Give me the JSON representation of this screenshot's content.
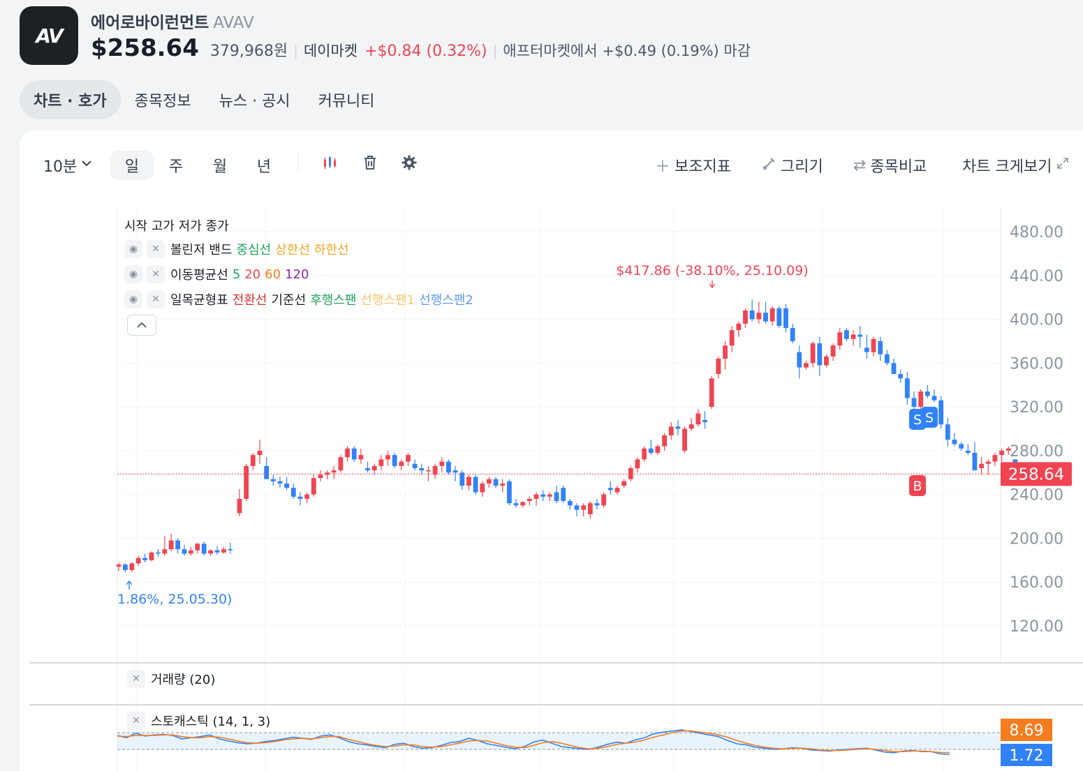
{
  "header": {
    "logo_text": "AV",
    "name": "에어로바이런먼트",
    "ticker": "AVAV",
    "price": "$258.64",
    "price_krw": "379,968원",
    "market_label": "데이마켓",
    "change": "+$0.84 (0.32%)",
    "after_market": "애프터마켓에서 +$0.49 (0.19%) 마감"
  },
  "tabs": [
    "차트 · 호가",
    "종목정보",
    "뉴스 · 공시",
    "커뮤니티"
  ],
  "toolbar": {
    "interval": "10분",
    "periods": [
      "일",
      "주",
      "월",
      "년"
    ],
    "indicator": "보조지표",
    "draw": "그리기",
    "compare": "종목비교",
    "expand": "차트 크게보기"
  },
  "legend": {
    "ohlc": "시작 고가 저가 종가",
    "bollinger": {
      "title": "볼린저 밴드",
      "items": [
        "중심선",
        "상한선",
        "하한선"
      ]
    },
    "ma": {
      "title": "이동평균선",
      "items": [
        "5",
        "20",
        "60",
        "120"
      ]
    },
    "ichimoku": {
      "title": "일목균형표",
      "items": [
        "전환선",
        "기준선",
        "후행스팬",
        "선행스팬1",
        "선행스팬2"
      ]
    }
  },
  "colors": {
    "up": "#f04452",
    "down": "#3182f6",
    "bb_mid": "#20a45a",
    "bb_upper": "#f5a623",
    "bb_lower": "#f5a623",
    "ma5": "#20a45a",
    "ma20": "#f04452",
    "ma60": "#f57c1f",
    "ma120": "#8e24aa",
    "ich_conv": "#d32f2f",
    "ich_base": "#191f28",
    "ich_lag": "#20a45a",
    "ich_spanA": "#f7c66b",
    "ich_spanB": "#5a9bf0",
    "stoch_k": "#3182f6",
    "stoch_d": "#f57c1f",
    "stoch_band": "#e8f3fd"
  },
  "chart_data": {
    "type": "candlestick",
    "y_ticks": [
      "480.00",
      "440.00",
      "400.00",
      "360.00",
      "320.00",
      "280.00",
      "240.00",
      "200.00",
      "160.00",
      "120.00"
    ],
    "ylim": [
      100,
      490
    ],
    "current_price_label": "258.64",
    "current_price": 258.64,
    "high_annotation": "$417.86 (-38.10%, 25.10.09)",
    "low_annotation": "1.86%, 25.05.30)",
    "markers": [
      {
        "label": "S",
        "type": "sell"
      },
      {
        "label": "S",
        "type": "sell"
      },
      {
        "label": "B",
        "type": "buy"
      }
    ],
    "candles": [
      [
        174,
        178,
        170,
        176
      ],
      [
        176,
        177,
        169,
        171
      ],
      [
        171,
        178,
        169,
        177
      ],
      [
        177,
        184,
        175,
        182
      ],
      [
        182,
        186,
        178,
        180
      ],
      [
        180,
        188,
        179,
        187
      ],
      [
        187,
        190,
        183,
        186
      ],
      [
        186,
        202,
        184,
        190
      ],
      [
        190,
        204,
        188,
        198
      ],
      [
        198,
        200,
        186,
        190
      ],
      [
        190,
        194,
        184,
        186
      ],
      [
        186,
        192,
        184,
        189
      ],
      [
        189,
        196,
        186,
        195
      ],
      [
        195,
        197,
        184,
        186
      ],
      [
        186,
        190,
        184,
        189
      ],
      [
        189,
        193,
        185,
        187
      ],
      [
        187,
        192,
        186,
        190
      ],
      [
        190,
        196,
        186,
        189
      ],
      [
        223,
        245,
        220,
        236
      ],
      [
        236,
        268,
        234,
        266
      ],
      [
        266,
        278,
        262,
        276
      ],
      [
        276,
        290,
        268,
        280
      ],
      [
        266,
        274,
        256,
        254
      ],
      [
        254,
        258,
        248,
        252
      ],
      [
        252,
        256,
        246,
        250
      ],
      [
        250,
        256,
        244,
        246
      ],
      [
        246,
        250,
        236,
        238
      ],
      [
        238,
        242,
        230,
        236
      ],
      [
        236,
        242,
        232,
        240
      ],
      [
        240,
        258,
        238,
        255
      ],
      [
        255,
        262,
        252,
        258
      ],
      [
        258,
        262,
        254,
        260
      ],
      [
        260,
        266,
        254,
        262
      ],
      [
        262,
        276,
        260,
        274
      ],
      [
        274,
        284,
        270,
        282
      ],
      [
        282,
        284,
        270,
        272
      ],
      [
        272,
        282,
        268,
        276
      ],
      [
        264,
        270,
        260,
        262
      ],
      [
        262,
        268,
        258,
        266
      ],
      [
        266,
        276,
        262,
        272
      ],
      [
        272,
        280,
        266,
        276
      ],
      [
        276,
        278,
        264,
        266
      ],
      [
        266,
        272,
        262,
        270
      ],
      [
        270,
        278,
        266,
        276
      ],
      [
        268,
        272,
        262,
        264
      ],
      [
        264,
        268,
        258,
        262
      ],
      [
        262,
        266,
        252,
        262
      ],
      [
        258,
        268,
        254,
        266
      ],
      [
        266,
        274,
        260,
        270
      ],
      [
        270,
        272,
        258,
        260
      ],
      [
        262,
        266,
        252,
        260
      ],
      [
        260,
        262,
        244,
        248
      ],
      [
        248,
        258,
        244,
        256
      ],
      [
        256,
        258,
        240,
        242
      ],
      [
        242,
        252,
        238,
        250
      ],
      [
        250,
        256,
        246,
        254
      ],
      [
        254,
        256,
        246,
        248
      ],
      [
        248,
        254,
        242,
        250
      ],
      [
        252,
        254,
        230,
        232
      ],
      [
        232,
        236,
        228,
        230
      ],
      [
        230,
        234,
        228,
        233
      ],
      [
        234,
        238,
        230,
        236
      ],
      [
        236,
        242,
        230,
        240
      ],
      [
        240,
        244,
        234,
        238
      ],
      [
        238,
        242,
        234,
        240
      ],
      [
        242,
        248,
        232,
        234
      ],
      [
        246,
        248,
        232,
        234
      ],
      [
        234,
        236,
        226,
        230
      ],
      [
        230,
        232,
        220,
        226
      ],
      [
        226,
        232,
        220,
        230
      ],
      [
        222,
        234,
        218,
        232
      ],
      [
        232,
        236,
        226,
        230
      ],
      [
        230,
        242,
        228,
        240
      ],
      [
        246,
        252,
        240,
        244
      ],
      [
        242,
        248,
        240,
        246
      ],
      [
        248,
        254,
        246,
        252
      ],
      [
        254,
        266,
        252,
        264
      ],
      [
        264,
        274,
        260,
        272
      ],
      [
        272,
        284,
        270,
        282
      ],
      [
        282,
        290,
        276,
        278
      ],
      [
        278,
        286,
        276,
        284
      ],
      [
        284,
        296,
        280,
        294
      ],
      [
        294,
        306,
        290,
        302
      ],
      [
        302,
        308,
        294,
        300
      ],
      [
        280,
        302,
        278,
        300
      ],
      [
        300,
        310,
        298,
        304
      ],
      [
        304,
        318,
        302,
        314
      ],
      [
        308,
        316,
        300,
        306
      ],
      [
        320,
        348,
        318,
        346
      ],
      [
        350,
        366,
        346,
        364
      ],
      [
        364,
        380,
        354,
        376
      ],
      [
        376,
        394,
        370,
        390
      ],
      [
        390,
        398,
        384,
        396
      ],
      [
        396,
        410,
        392,
        408
      ],
      [
        408,
        418,
        398,
        400
      ],
      [
        400,
        416,
        396,
        406
      ],
      [
        406,
        416,
        396,
        398
      ],
      [
        398,
        412,
        394,
        410
      ],
      [
        410,
        412,
        392,
        394
      ],
      [
        410,
        414,
        388,
        392
      ],
      [
        392,
        396,
        378,
        380
      ],
      [
        370,
        376,
        346,
        356
      ],
      [
        356,
        362,
        354,
        360
      ],
      [
        360,
        380,
        356,
        378
      ],
      [
        378,
        384,
        348,
        358
      ],
      [
        358,
        368,
        356,
        366
      ],
      [
        366,
        378,
        362,
        376
      ],
      [
        376,
        392,
        372,
        388
      ],
      [
        390,
        392,
        380,
        382
      ],
      [
        382,
        390,
        376,
        386
      ],
      [
        386,
        394,
        374,
        384
      ],
      [
        374,
        386,
        364,
        370
      ],
      [
        370,
        384,
        366,
        382
      ],
      [
        380,
        384,
        362,
        368
      ],
      [
        368,
        372,
        358,
        360
      ],
      [
        360,
        364,
        350,
        350
      ],
      [
        350,
        354,
        342,
        346
      ],
      [
        346,
        352,
        322,
        328
      ],
      [
        328,
        334,
        310,
        320
      ],
      [
        320,
        336,
        316,
        334
      ],
      [
        334,
        340,
        328,
        330
      ],
      [
        330,
        336,
        324,
        326
      ],
      [
        326,
        330,
        300,
        304
      ],
      [
        304,
        310,
        284,
        290
      ],
      [
        290,
        296,
        284,
        286
      ],
      [
        286,
        288,
        280,
        282
      ],
      [
        280,
        286,
        276,
        278
      ],
      [
        278,
        288,
        262,
        262
      ],
      [
        264,
        274,
        258,
        268
      ],
      [
        268,
        272,
        258,
        270
      ],
      [
        270,
        278,
        266,
        276
      ],
      [
        276,
        282,
        270,
        280
      ],
      [
        280,
        284,
        276,
        282
      ],
      [
        272,
        272,
        258,
        258
      ]
    ]
  },
  "volume": {
    "label": "거래량 (20)"
  },
  "stochastic": {
    "label": "스토캐스틱 (14, 1, 3)",
    "d_value": "8.69",
    "k_value": "1.72",
    "upper_band": 80,
    "lower_band": 20,
    "k": [
      70,
      62,
      78,
      68,
      72,
      74,
      70,
      58,
      62,
      66,
      72,
      58,
      50,
      44,
      40,
      42,
      48,
      52,
      58,
      64,
      60,
      56,
      68,
      72,
      62,
      48,
      40,
      36,
      30,
      26,
      38,
      42,
      30,
      24,
      26,
      34,
      44,
      48,
      60,
      52,
      40,
      34,
      28,
      22,
      30,
      46,
      54,
      42,
      30,
      26,
      22,
      20,
      28,
      38,
      46,
      42,
      54,
      62,
      76,
      82,
      86,
      90,
      84,
      78,
      72,
      66,
      52,
      40,
      36,
      28,
      24,
      20,
      22,
      26,
      24,
      18,
      16,
      14,
      18,
      20,
      22,
      24,
      18,
      10,
      8,
      14,
      16,
      12,
      12,
      4,
      2
    ],
    "d": [
      68,
      66,
      70,
      70,
      70,
      72,
      72,
      66,
      62,
      62,
      66,
      64,
      58,
      50,
      44,
      42,
      44,
      48,
      54,
      58,
      60,
      58,
      62,
      66,
      66,
      56,
      48,
      40,
      34,
      30,
      32,
      36,
      36,
      30,
      28,
      30,
      36,
      42,
      50,
      52,
      50,
      42,
      34,
      28,
      26,
      34,
      44,
      48,
      42,
      34,
      26,
      22,
      24,
      30,
      38,
      42,
      46,
      54,
      64,
      72,
      80,
      86,
      86,
      82,
      78,
      72,
      64,
      52,
      42,
      34,
      28,
      24,
      22,
      24,
      24,
      22,
      18,
      16,
      16,
      18,
      20,
      22,
      20,
      16,
      12,
      12,
      14,
      14,
      12,
      9,
      8.69
    ]
  }
}
